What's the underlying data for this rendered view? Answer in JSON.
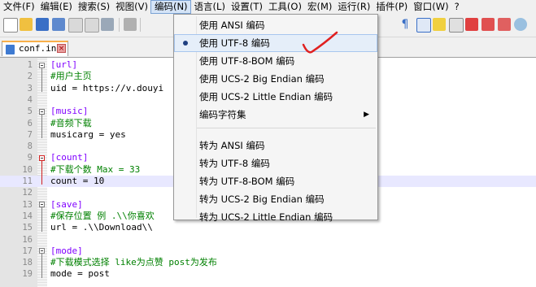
{
  "menubar": {
    "items": [
      "文件(F)",
      "编辑(E)",
      "搜索(S)",
      "视图(V)",
      "编码(N)",
      "语言(L)",
      "设置(T)",
      "工具(O)",
      "宏(M)",
      "运行(R)",
      "插件(P)",
      "窗口(W)",
      "?"
    ]
  },
  "tab": {
    "label": "conf.ini",
    "close": "×"
  },
  "editor": {
    "line_numbers": [
      "1",
      "2",
      "3",
      "4",
      "5",
      "6",
      "7",
      "8",
      "9",
      "10",
      "11",
      "12",
      "13",
      "14",
      "15",
      "16",
      "17",
      "18",
      "19"
    ],
    "lines": [
      "[url]",
      "#用户主页",
      "uid = https://v.douyi",
      "",
      "[music]",
      "#音频下载",
      "musicarg = yes",
      "",
      "[count]",
      "#下载个数 Max = 33",
      "count = 10",
      "",
      "[save]",
      "#保存位置 例 .\\\\你喜欢",
      "url = .\\\\Download\\\\",
      "",
      "[mode]",
      "#下载模式选择 like为点赞 post为发布",
      "mode = post"
    ]
  },
  "encoding_menu": {
    "items": [
      "使用 ANSI 编码",
      "使用 UTF-8 编码",
      "使用 UTF-8-BOM 编码",
      "使用 UCS-2 Big Endian 编码",
      "使用 UCS-2 Little Endian 编码",
      "编码字符集",
      "转为 ANSI 编码",
      "转为 UTF-8 编码",
      "转为 UTF-8-BOM 编码",
      "转为 UCS-2 Big Endian 编码",
      "转为 UCS-2 Little Endian 编码"
    ],
    "selected": "使用 UTF-8 编码",
    "submenu_arrow": "▶"
  },
  "colors": {
    "section": "#8000ff",
    "comment": "#008000",
    "annotation": "#e02020",
    "highlight": "#e8e8ff"
  },
  "icons": [
    "new-file-icon",
    "open-folder-icon",
    "save-icon",
    "save-all-icon",
    "close-icon",
    "close-all-icon",
    "print-icon",
    "cut-icon",
    "pilcrow-icon",
    "word-wrap-icon",
    "macro-icon",
    "bookmark-icon",
    "doc-map-icon",
    "function-list-icon",
    "eye-icon"
  ]
}
